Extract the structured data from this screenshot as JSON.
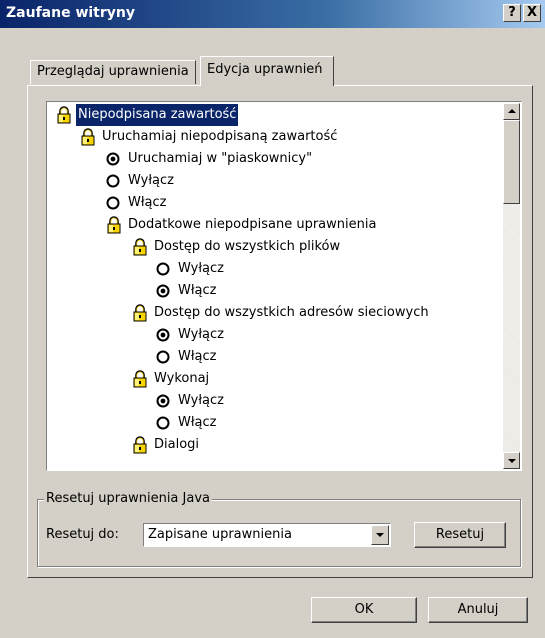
{
  "window": {
    "title": "Zaufane witryny",
    "help_label": "?",
    "close_label": "X"
  },
  "tabs": [
    {
      "label": "Przeglądaj uprawnienia",
      "active": false
    },
    {
      "label": "Edycja uprawnień",
      "active": true
    }
  ],
  "tree": {
    "items": [
      {
        "label": "Niepodpisana zawartość",
        "icon": "lock-icon",
        "selected": true
      },
      {
        "label": "Uruchamiaj niepodpisaną zawartość",
        "icon": "lock-icon"
      },
      {
        "label": "Uruchamiaj w \"piaskownicy\"",
        "icon": "radio-icon",
        "checked": true
      },
      {
        "label": "Wyłącz",
        "icon": "radio-icon",
        "checked": false
      },
      {
        "label": "Włącz",
        "icon": "radio-icon",
        "checked": false
      },
      {
        "label": "Dodatkowe niepodpisane uprawnienia",
        "icon": "lock-icon"
      },
      {
        "label": "Dostęp do wszystkich plików",
        "icon": "lock-icon"
      },
      {
        "label": "Wyłącz",
        "icon": "radio-icon",
        "checked": false
      },
      {
        "label": "Włącz",
        "icon": "radio-icon",
        "checked": true
      },
      {
        "label": "Dostęp do wszystkich adresów sieciowych",
        "icon": "lock-icon"
      },
      {
        "label": "Wyłącz",
        "icon": "radio-icon",
        "checked": true
      },
      {
        "label": "Włącz",
        "icon": "radio-icon",
        "checked": false
      },
      {
        "label": "Wykonaj",
        "icon": "lock-icon"
      },
      {
        "label": "Wyłącz",
        "icon": "radio-icon",
        "checked": true
      },
      {
        "label": "Włącz",
        "icon": "radio-icon",
        "checked": false
      },
      {
        "label": "Dialogi",
        "icon": "lock-icon"
      }
    ]
  },
  "reset_group": {
    "title": "Resetuj uprawnienia Java",
    "label": "Resetuj do:",
    "combo_value": "Zapisane uprawnienia",
    "reset_button": "Resetuj"
  },
  "buttons": {
    "ok": "OK",
    "cancel": "Anuluj"
  },
  "colors": {
    "selection": "#0a246a",
    "face": "#d4d0c8"
  }
}
